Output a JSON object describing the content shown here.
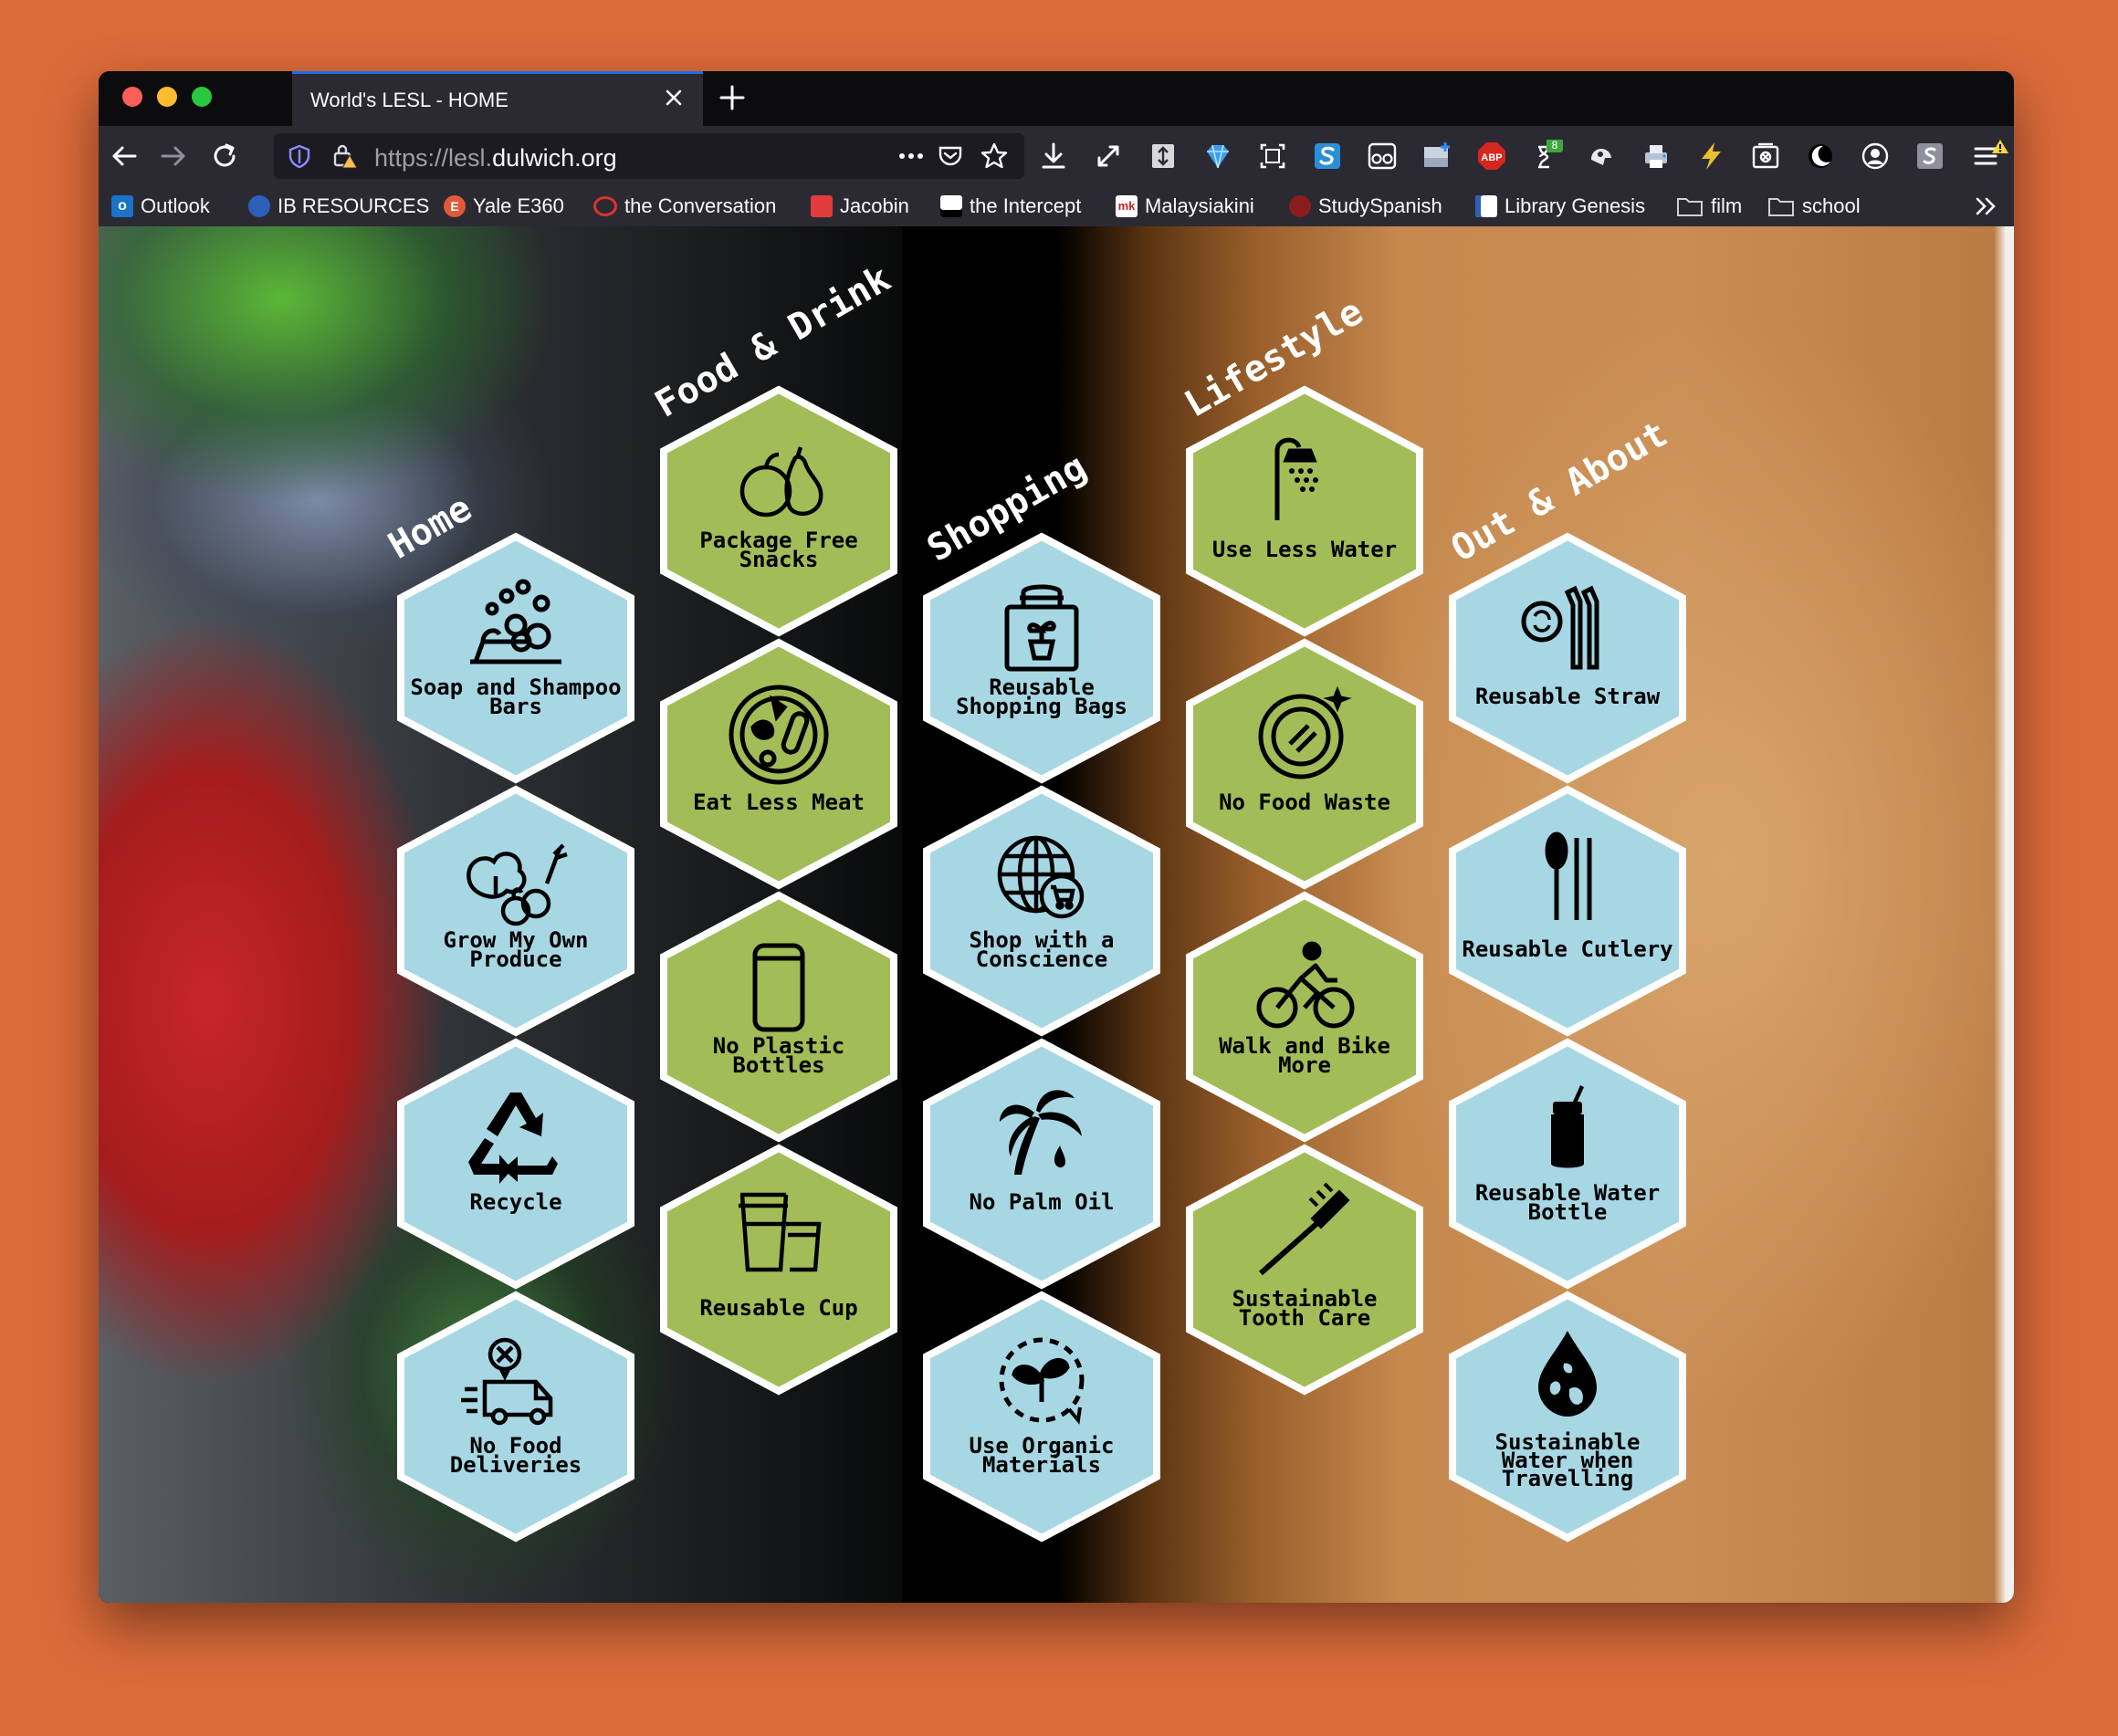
{
  "browser": {
    "tab_title": "World's LESL - HOME",
    "url_prefix": "https://lesl.",
    "url_host": "dulwich.org",
    "adblock_label": "ABP",
    "badge_count": "8"
  },
  "bookmarks": [
    {
      "label": "Outlook",
      "icon": "outlook-icon",
      "color": "#1a73c9"
    },
    {
      "label": "IB RESOURCES",
      "icon": "ib-icon",
      "color": "#2d5fb8"
    },
    {
      "label": "Yale E360",
      "icon": "yale-icon",
      "color": "#e05a3a"
    },
    {
      "label": "the Conversation",
      "icon": "conversation-icon",
      "color": "#d8352a"
    },
    {
      "label": "Jacobin",
      "icon": "jacobin-icon",
      "color": "#e23b3b"
    },
    {
      "label": "the Intercept",
      "icon": "intercept-icon",
      "color": "#000000"
    },
    {
      "label": "Malaysiakini",
      "icon": "malaysiakini-icon",
      "color": "#ffffff"
    },
    {
      "label": "StudySpanish",
      "icon": "studyspanish-icon",
      "color": "#8a1d1d"
    },
    {
      "label": "Library Genesis",
      "icon": "libgen-icon",
      "color": "#ffffff"
    },
    {
      "label": "film",
      "icon": "folder-icon",
      "color": "#cfcfd6"
    },
    {
      "label": "school",
      "icon": "folder-icon",
      "color": "#cfcfd6"
    }
  ],
  "categories": {
    "home": "Home",
    "food": "Food & Drink",
    "shopping": "Shopping",
    "lifestyle": "Lifestyle",
    "out": "Out & About"
  },
  "colors": {
    "blue_hex": "#a8d7e4",
    "green_hex": "#a2bc58",
    "hex_border": "#ffffff"
  },
  "tiles": {
    "soap": [
      "Soap and Shampoo",
      "Bars"
    ],
    "grow": [
      "Grow My Own",
      "Produce"
    ],
    "recycle": [
      "Recycle"
    ],
    "nofood_deliv": [
      "No Food",
      "Deliveries"
    ],
    "snacks": [
      "Package Free",
      "Snacks"
    ],
    "meat": [
      "Eat Less Meat"
    ],
    "bottles": [
      "No Plastic",
      "Bottles"
    ],
    "cup": [
      "Reusable Cup"
    ],
    "bags": [
      "Reusable",
      "Shopping Bags"
    ],
    "conscience": [
      "Shop with a",
      "Conscience"
    ],
    "palm": [
      "No Palm Oil"
    ],
    "organic": [
      "Use Organic",
      "Materials"
    ],
    "water": [
      "Use Less Water"
    ],
    "waste": [
      "No Food Waste"
    ],
    "bike": [
      "Walk and Bike",
      "More"
    ],
    "tooth": [
      "Sustainable",
      "Tooth Care"
    ],
    "straw": [
      "Reusable Straw"
    ],
    "cutlery": [
      "Reusable Cutlery"
    ],
    "waterbottle": [
      "Reusable Water",
      "Bottle"
    ],
    "travel": [
      "Sustainable",
      "Water when",
      "Travelling"
    ]
  }
}
